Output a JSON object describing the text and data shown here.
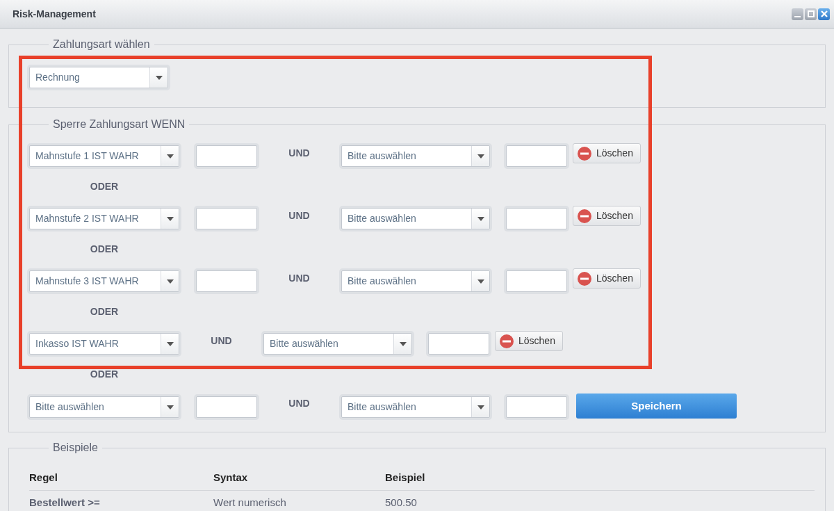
{
  "window": {
    "title": "Risk-Management"
  },
  "payment": {
    "legend": "Zahlungsart wählen",
    "select": "Rechnung"
  },
  "block": {
    "legend": "Sperre Zahlungsart WENN",
    "rules": [
      {
        "condition": "Mahnstufe 1 IST WAHR",
        "has_value": true,
        "joiner": "UND",
        "second": "Bitte auswählen",
        "action": {
          "kind": "delete",
          "label": "Löschen"
        }
      },
      {
        "prefix": "ODER",
        "condition": "Mahnstufe 2 IST WAHR",
        "has_value": true,
        "joiner": "UND",
        "second": "Bitte auswählen",
        "action": {
          "kind": "delete",
          "label": "Löschen"
        }
      },
      {
        "prefix": "ODER",
        "condition": "Mahnstufe 3 IST WAHR",
        "has_value": true,
        "joiner": "UND",
        "second": "Bitte auswählen",
        "action": {
          "kind": "delete",
          "label": "Löschen"
        }
      },
      {
        "prefix": "ODER",
        "condition": "Inkasso IST WAHR",
        "has_value": false,
        "joiner": "UND",
        "second": "Bitte auswählen",
        "action": {
          "kind": "delete",
          "label": "Löschen"
        }
      },
      {
        "prefix": "ODER",
        "condition": "Bitte auswählen",
        "has_value": true,
        "joiner": "UND",
        "second": "Bitte auswählen",
        "action": {
          "kind": "save",
          "label": "Speichern"
        }
      }
    ]
  },
  "examples": {
    "legend": "Beispiele",
    "columns": [
      "Regel",
      "Syntax",
      "Beispiel"
    ],
    "rows": [
      [
        "Bestellwert >=",
        "Wert numerisch",
        "500.50"
      ]
    ]
  }
}
